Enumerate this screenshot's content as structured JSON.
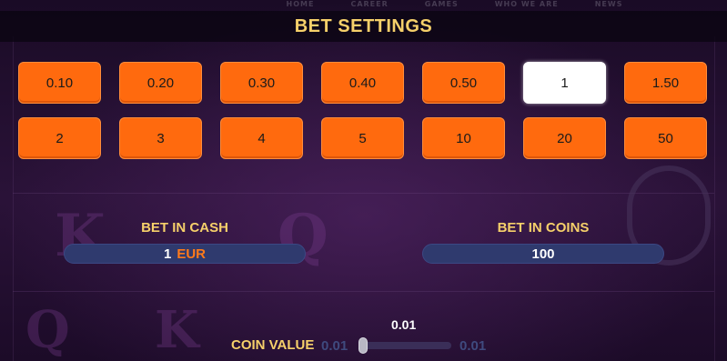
{
  "background_nav": [
    "HOME",
    "CAREER",
    "GAMES",
    "WHO WE ARE",
    "NEWS"
  ],
  "title": "BET SETTINGS",
  "bet_options": [
    "0.10",
    "0.20",
    "0.30",
    "0.40",
    "0.50",
    "1",
    "1.50",
    "2",
    "3",
    "4",
    "5",
    "10",
    "20",
    "50"
  ],
  "selected_bet": "1",
  "bet_in_cash": {
    "label": "BET IN CASH",
    "value": "1",
    "currency": "EUR"
  },
  "bet_in_coins": {
    "label": "BET IN COINS",
    "value": "100"
  },
  "coin_value": {
    "label": "COIN VALUE",
    "current": "0.01",
    "min": "0.01",
    "max": "0.01",
    "fill_fraction": 0
  },
  "colors": {
    "accent_gold": "#f6d06a",
    "button_orange": "#ff6a0e",
    "pill_blue": "#2f3a6e",
    "currency_orange": "#ff7a1a"
  }
}
